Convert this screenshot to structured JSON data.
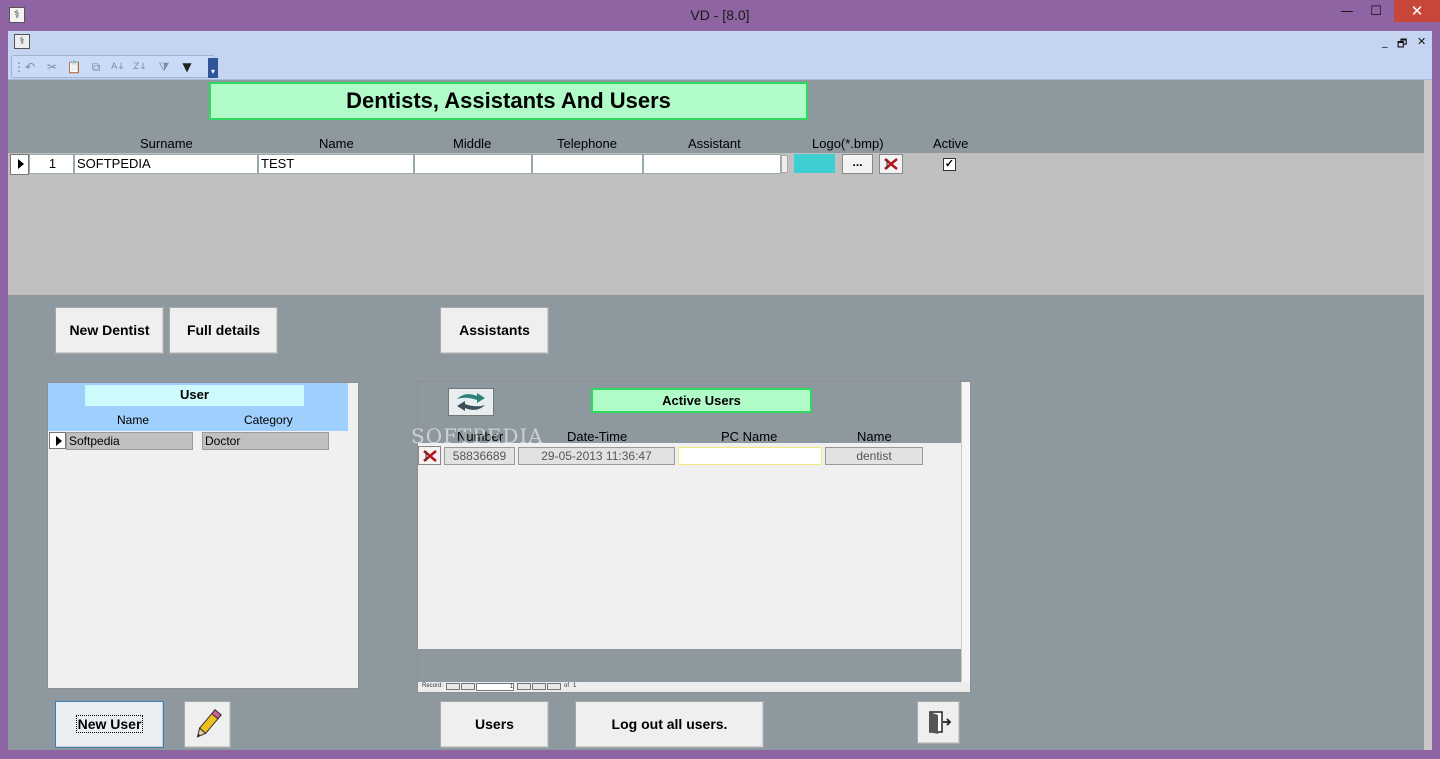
{
  "window": {
    "title": "VD - [8.0]",
    "minimize": "—",
    "maximize": "☐",
    "close": "✕"
  },
  "mdi": {
    "minimize": "_",
    "restore": "🗗",
    "close": "✕"
  },
  "toolbar": {
    "icons": [
      "undo-icon",
      "cut-icon",
      "paste-icon",
      "copy-icon",
      "sort-ascending-icon",
      "sort-descending-icon",
      "filter-clear-icon",
      "filter-icon"
    ]
  },
  "form": {
    "title": "Dentists, Assistants And Users"
  },
  "dentists": {
    "columns": {
      "surname": "Surname",
      "name": "Name",
      "middle": "Middle",
      "telephone": "Telephone",
      "assistant": "Assistant",
      "logo": "Logo(*.bmp)",
      "active": "Active"
    },
    "row": {
      "index": "1",
      "surname": "SOFTPEDIA",
      "name": "TEST",
      "middle": "",
      "telephone": "",
      "assistant": "",
      "logo_browse": "...",
      "active": "✓"
    },
    "logo_color": "#3ecfd3"
  },
  "buttons": {
    "new_dentist": "New Dentist",
    "full_details": "Full details",
    "assistants": "Assistants",
    "new_user": "New User",
    "users": "Users",
    "logout_all": "Log out all users."
  },
  "user_panel": {
    "title": "User",
    "col_name": "Name",
    "col_category": "Category",
    "rows": [
      {
        "name": "Softpedia",
        "category": "Doctor"
      }
    ]
  },
  "active_users": {
    "title": "Active Users",
    "col_number": "Number",
    "col_datetime": "Date-Time",
    "col_pcname": "PC Name",
    "col_name": "Name",
    "rows": [
      {
        "number": "58836689",
        "datetime": "29-05-2013 11:36:47",
        "pcname": "",
        "name": "dentist"
      }
    ],
    "nav": {
      "record_label": "Record:",
      "current": "1",
      "of_label": "of",
      "total": "1"
    }
  },
  "watermark": "SOFTPEDIA",
  "colors": {
    "title_bar": "#8e64a3",
    "form_bg": "#8d999f",
    "header_green": "#b1fbc9",
    "header_green_border": "#2fd95d",
    "user_header": "#9fcffd"
  }
}
